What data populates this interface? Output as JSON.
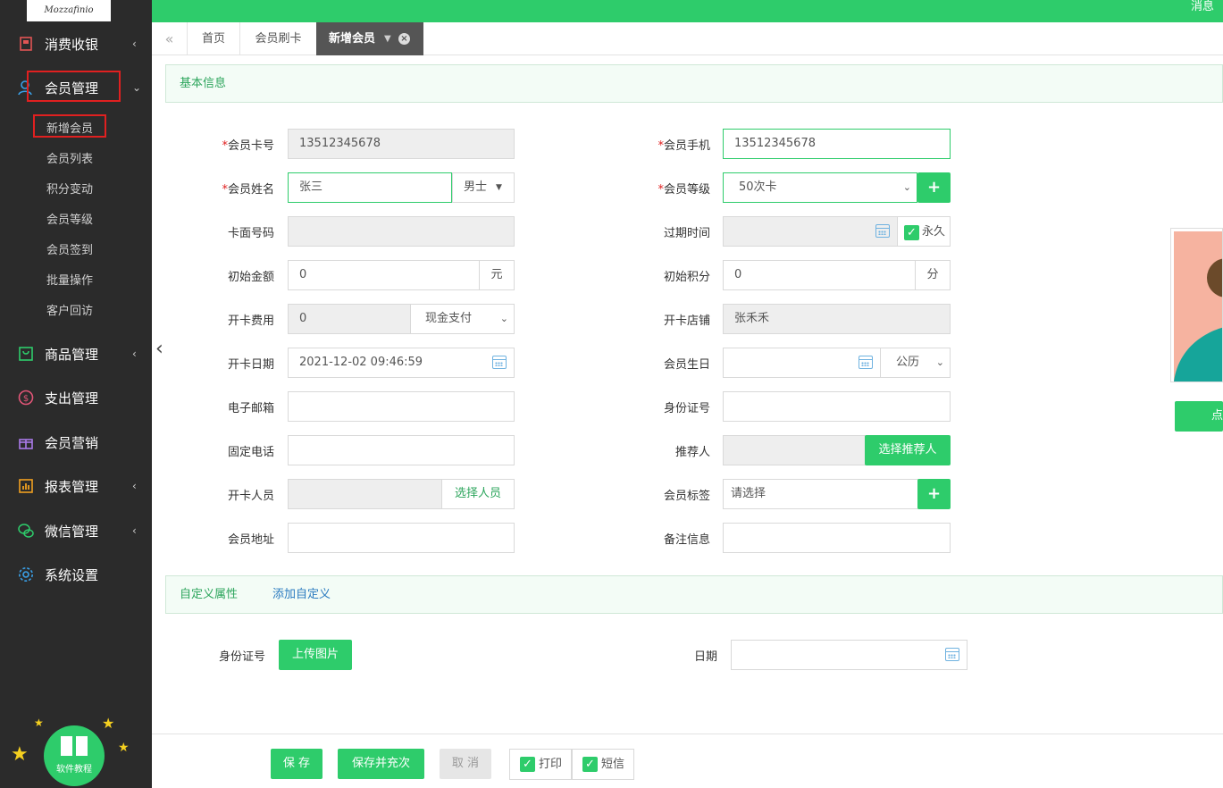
{
  "app": {
    "logo_text": "Mozzafinio",
    "message": "消息"
  },
  "sidebar": {
    "menu": [
      {
        "label": "消费收银",
        "icon": "cashier-icon"
      },
      {
        "label": "会员管理",
        "icon": "user-icon"
      },
      {
        "label": "商品管理",
        "icon": "product-icon"
      },
      {
        "label": "支出管理",
        "icon": "expense-icon"
      },
      {
        "label": "会员营销",
        "icon": "gift-icon"
      },
      {
        "label": "报表管理",
        "icon": "report-icon"
      },
      {
        "label": "微信管理",
        "icon": "wechat-icon"
      },
      {
        "label": "系统设置",
        "icon": "gear-icon"
      }
    ],
    "sub_items": [
      "新增会员",
      "会员列表",
      "积分变动",
      "会员等级",
      "会员签到",
      "批量操作",
      "客户回访"
    ],
    "tutorial_label": "软件教程"
  },
  "tabs": [
    "首页",
    "会员刷卡",
    "新增会员"
  ],
  "section": {
    "basic_info": "基本信息",
    "custom_attr": "自定义属性",
    "add_custom": "添加自定义"
  },
  "form": {
    "card_no": {
      "label": "会员卡号",
      "value": "13512345678"
    },
    "name": {
      "label": "会员姓名",
      "value": "张三",
      "gender": "男士"
    },
    "card_face_no": {
      "label": "卡面号码",
      "value": ""
    },
    "init_amount": {
      "label": "初始金额",
      "value": "0",
      "unit": "元"
    },
    "card_fee": {
      "label": "开卡费用",
      "value": "0",
      "pay_method": "现金支付"
    },
    "open_date": {
      "label": "开卡日期",
      "value": "2021-12-02 09:46:59"
    },
    "email": {
      "label": "电子邮箱",
      "value": ""
    },
    "phone_fixed": {
      "label": "固定电话",
      "value": ""
    },
    "opener": {
      "label": "开卡人员",
      "value": "",
      "button": "选择人员"
    },
    "address": {
      "label": "会员地址",
      "value": ""
    },
    "mobile": {
      "label": "会员手机",
      "value": "13512345678"
    },
    "level": {
      "label": "会员等级",
      "value": "50次卡"
    },
    "expire": {
      "label": "过期时间",
      "value": "",
      "forever": "永久"
    },
    "init_points": {
      "label": "初始积分",
      "value": "0",
      "unit": "分"
    },
    "store": {
      "label": "开卡店铺",
      "value": "张禾禾"
    },
    "birthday": {
      "label": "会员生日",
      "value": "",
      "calendar": "公历"
    },
    "id_card": {
      "label": "身份证号",
      "value": ""
    },
    "referrer": {
      "label": "推荐人",
      "value": "",
      "button": "选择推荐人"
    },
    "tags": {
      "label": "会员标签",
      "placeholder": "请选择"
    },
    "remark": {
      "label": "备注信息",
      "value": ""
    }
  },
  "custom": {
    "id_card_label": "身份证号",
    "upload_button": "上传图片",
    "date_label": "日期",
    "date_value": ""
  },
  "photo": {
    "button_partial": "点"
  },
  "footer": {
    "save": "保 存",
    "save_recharge": "保存并充次",
    "cancel": "取 消",
    "print": "打印",
    "sms": "短信"
  }
}
